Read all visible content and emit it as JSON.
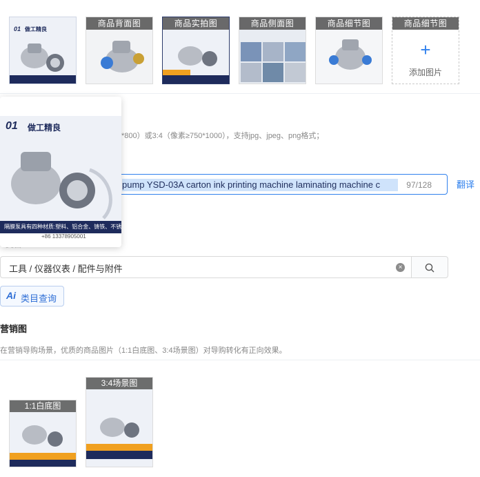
{
  "gallery": {
    "items": [
      {
        "label": "",
        "image": "product-front",
        "num": "01",
        "title": "做工精良"
      },
      {
        "label": "商品背面图",
        "image": "product-back"
      },
      {
        "label": "商品实拍图",
        "image": "product-real-photo"
      },
      {
        "label": "商品侧面图",
        "image": "product-side-factory"
      },
      {
        "label": "商品细节图",
        "image": "product-detail"
      }
    ],
    "add_slot": {
      "label": "商品细节图",
      "plus": "+",
      "text": "添加图片"
    }
  },
  "preview_popover": {
    "num": "01",
    "title": "做工精良",
    "caption": "隔膜泵具有四种材质:塑料、铝合金、铸铁、不锈钢",
    "footer": "+86 13378905001"
  },
  "image_hint": "*800）或3:4（像素≥750*1000），支持jpg、jpeg、png格式；",
  "title_field": {
    "value": "pump YSD-03A carton ink printing machine laminating machine c",
    "count": "97/128",
    "translate": "翻译"
  },
  "category": {
    "ghost_label": "类目",
    "value": "工具 / 仪器仪表 / 配件与附件",
    "clear_icon": "×",
    "ai_mark": "Ai",
    "ai_label": "类目查询"
  },
  "marketing": {
    "title": "营销图",
    "description": "在营销导购场景，优质的商品图片（1:1白底图、3:4场景图）对导购转化有正向效果。",
    "items": [
      {
        "label": "1:1白底图",
        "image": "marketing-square"
      },
      {
        "label": "3:4场景图",
        "image": "marketing-portrait"
      }
    ]
  },
  "colors": {
    "accent": "#2f80ed",
    "navy": "#1e2b5c",
    "orange": "#f0a020"
  }
}
